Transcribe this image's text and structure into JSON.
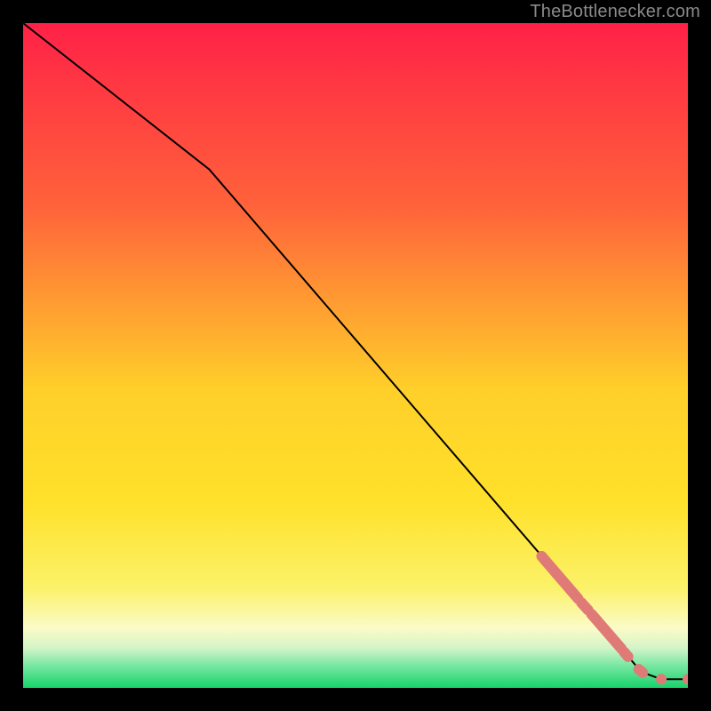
{
  "attribution": "TheBottlenecker.com",
  "colors": {
    "bg": "#000000",
    "gradient_top": "#ff2147",
    "gradient_mid_upper": "#ff8a2a",
    "gradient_mid": "#ffe12a",
    "gradient_mid_lower": "#fffb88",
    "gradient_low": "#f5ffb8",
    "gradient_green_top": "#6de89a",
    "gradient_green": "#17d36a",
    "line": "#000000",
    "marker_fill": "#e07a77",
    "marker_stroke": "#c86a67"
  },
  "chart_data": {
    "type": "line",
    "xlim": [
      0,
      100
    ],
    "ylim": [
      0,
      100
    ],
    "line_points": [
      {
        "x": 0,
        "y": 100
      },
      {
        "x": 28,
        "y": 78
      },
      {
        "x": 93,
        "y": 2.4
      },
      {
        "x": 96,
        "y": 1.3
      },
      {
        "x": 100,
        "y": 1.3
      }
    ],
    "marker_segments": [
      {
        "x1": 78.0,
        "y1": 19.8,
        "x2": 83.5,
        "y2": 13.4
      },
      {
        "x1": 84.0,
        "y1": 12.8,
        "x2": 85.0,
        "y2": 11.7
      },
      {
        "x1": 85.5,
        "y1": 11.1,
        "x2": 90.0,
        "y2": 5.9
      },
      {
        "x1": 90.4,
        "y1": 5.4,
        "x2": 91.0,
        "y2": 4.7
      },
      {
        "x1": 92.6,
        "y1": 2.8,
        "x2": 93.2,
        "y2": 2.3
      }
    ],
    "marker_dots": [
      {
        "x": 96.0,
        "y": 1.3
      },
      {
        "x": 100.0,
        "y": 1.3
      }
    ]
  }
}
